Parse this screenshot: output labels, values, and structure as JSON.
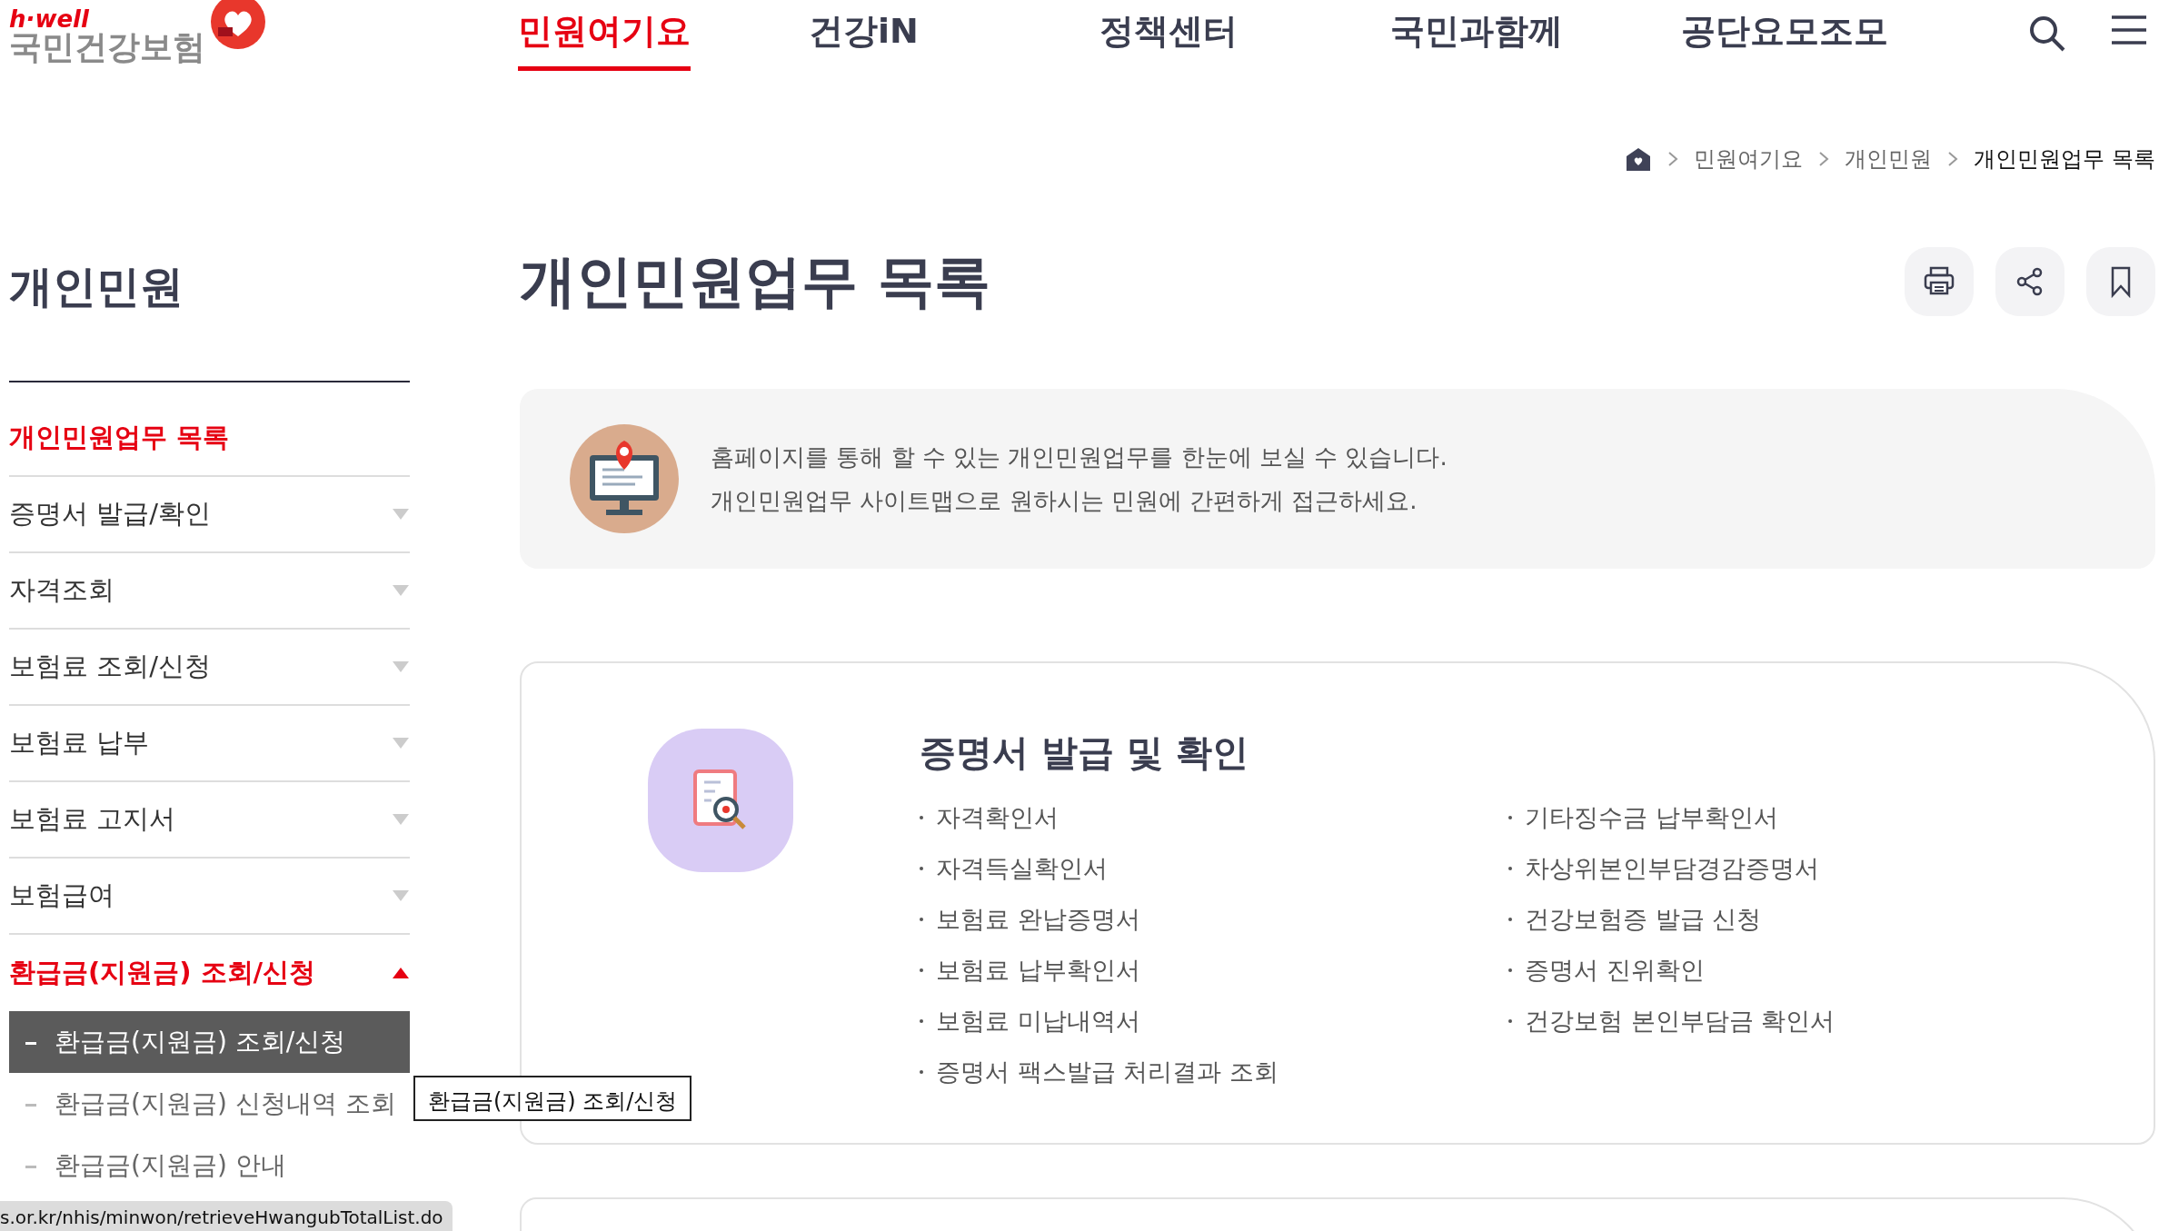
{
  "header": {
    "logo": {
      "tagline": "h·well",
      "name": "국민건강보험"
    },
    "nav": [
      {
        "label": "민원여기요",
        "selected": true
      },
      {
        "label": "건강iN",
        "selected": false
      },
      {
        "label": "정책센터",
        "selected": false
      },
      {
        "label": "국민과함께",
        "selected": false
      },
      {
        "label": "공단요모조모",
        "selected": false
      }
    ]
  },
  "breadcrumb": [
    "민원여기요",
    "개인민원",
    "개인민원업무 목록"
  ],
  "sidebar": {
    "title": "개인민원",
    "items": [
      {
        "label": "개인민원업무 목록",
        "kind": "link",
        "selected": true
      },
      {
        "label": "증명서 발급/확인",
        "kind": "group",
        "selected": false,
        "expanded": false
      },
      {
        "label": "자격조회",
        "kind": "group",
        "selected": false,
        "expanded": false
      },
      {
        "label": "보험료 조회/신청",
        "kind": "group",
        "selected": false,
        "expanded": false
      },
      {
        "label": "보험료 납부",
        "kind": "group",
        "selected": false,
        "expanded": false
      },
      {
        "label": "보험료 고지서",
        "kind": "group",
        "selected": false,
        "expanded": false
      },
      {
        "label": "보험급여",
        "kind": "group",
        "selected": false,
        "expanded": false
      },
      {
        "label": "환급금(지원금) 조회/신청",
        "kind": "group",
        "selected": true,
        "expanded": true,
        "children": [
          {
            "label": "환급금(지원금) 조회/신청",
            "selected": true
          },
          {
            "label": "환급금(지원금) 신청내역 조회",
            "selected": false
          },
          {
            "label": "환급금(지원금) 안내",
            "selected": false
          }
        ]
      }
    ]
  },
  "page": {
    "title": "개인민원업무 목록"
  },
  "intro": {
    "lines": [
      "홈페이지를 통해 할 수 있는 개인민원업무를 한눈에 보실 수 있습니다.",
      "개인민원업무 사이트맵으로 원하시는 민원에 간편하게 접근하세요."
    ]
  },
  "sections": [
    {
      "title": "증명서 발급 및 확인",
      "columns": [
        [
          "자격확인서",
          "자격득실확인서",
          "보험료 완납증명서",
          "보험료 납부확인서",
          "보험료 미납내역서",
          "증명서 팩스발급 처리결과 조회"
        ],
        [
          "기타징수금 납부확인서",
          "차상위본인부담경감증명서",
          "건강보험증 발급 신청",
          "증명서 진위확인",
          "건강보험 본인부담금 확인서"
        ]
      ]
    }
  ],
  "tooltip": {
    "text": "환급금(지원금) 조회/신청"
  },
  "status_bar": {
    "url": "s.or.kr/nhis/minwon/retrieveHwangubTotalList.do"
  }
}
